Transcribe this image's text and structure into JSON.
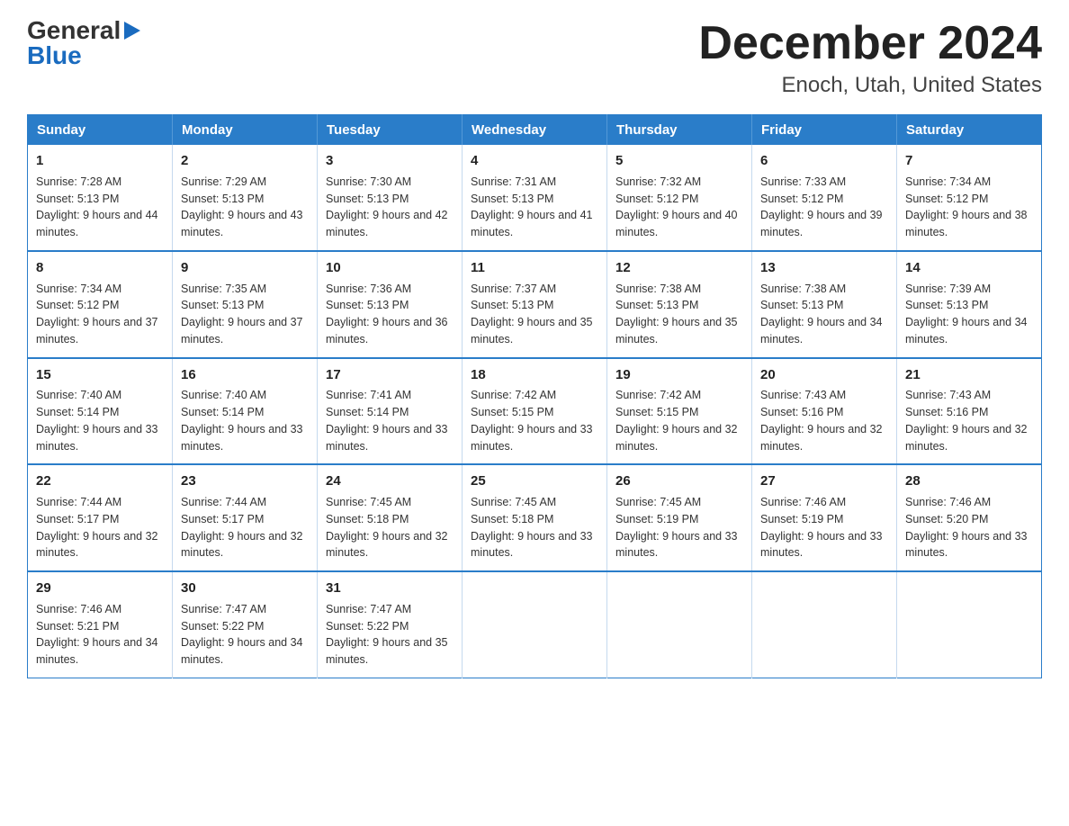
{
  "logo": {
    "general": "General",
    "blue": "Blue",
    "arrow": "▶"
  },
  "title": "December 2024",
  "subtitle": "Enoch, Utah, United States",
  "days_of_week": [
    "Sunday",
    "Monday",
    "Tuesday",
    "Wednesday",
    "Thursday",
    "Friday",
    "Saturday"
  ],
  "weeks": [
    [
      {
        "day": "1",
        "sunrise": "Sunrise: 7:28 AM",
        "sunset": "Sunset: 5:13 PM",
        "daylight": "Daylight: 9 hours and 44 minutes."
      },
      {
        "day": "2",
        "sunrise": "Sunrise: 7:29 AM",
        "sunset": "Sunset: 5:13 PM",
        "daylight": "Daylight: 9 hours and 43 minutes."
      },
      {
        "day": "3",
        "sunrise": "Sunrise: 7:30 AM",
        "sunset": "Sunset: 5:13 PM",
        "daylight": "Daylight: 9 hours and 42 minutes."
      },
      {
        "day": "4",
        "sunrise": "Sunrise: 7:31 AM",
        "sunset": "Sunset: 5:13 PM",
        "daylight": "Daylight: 9 hours and 41 minutes."
      },
      {
        "day": "5",
        "sunrise": "Sunrise: 7:32 AM",
        "sunset": "Sunset: 5:12 PM",
        "daylight": "Daylight: 9 hours and 40 minutes."
      },
      {
        "day": "6",
        "sunrise": "Sunrise: 7:33 AM",
        "sunset": "Sunset: 5:12 PM",
        "daylight": "Daylight: 9 hours and 39 minutes."
      },
      {
        "day": "7",
        "sunrise": "Sunrise: 7:34 AM",
        "sunset": "Sunset: 5:12 PM",
        "daylight": "Daylight: 9 hours and 38 minutes."
      }
    ],
    [
      {
        "day": "8",
        "sunrise": "Sunrise: 7:34 AM",
        "sunset": "Sunset: 5:12 PM",
        "daylight": "Daylight: 9 hours and 37 minutes."
      },
      {
        "day": "9",
        "sunrise": "Sunrise: 7:35 AM",
        "sunset": "Sunset: 5:13 PM",
        "daylight": "Daylight: 9 hours and 37 minutes."
      },
      {
        "day": "10",
        "sunrise": "Sunrise: 7:36 AM",
        "sunset": "Sunset: 5:13 PM",
        "daylight": "Daylight: 9 hours and 36 minutes."
      },
      {
        "day": "11",
        "sunrise": "Sunrise: 7:37 AM",
        "sunset": "Sunset: 5:13 PM",
        "daylight": "Daylight: 9 hours and 35 minutes."
      },
      {
        "day": "12",
        "sunrise": "Sunrise: 7:38 AM",
        "sunset": "Sunset: 5:13 PM",
        "daylight": "Daylight: 9 hours and 35 minutes."
      },
      {
        "day": "13",
        "sunrise": "Sunrise: 7:38 AM",
        "sunset": "Sunset: 5:13 PM",
        "daylight": "Daylight: 9 hours and 34 minutes."
      },
      {
        "day": "14",
        "sunrise": "Sunrise: 7:39 AM",
        "sunset": "Sunset: 5:13 PM",
        "daylight": "Daylight: 9 hours and 34 minutes."
      }
    ],
    [
      {
        "day": "15",
        "sunrise": "Sunrise: 7:40 AM",
        "sunset": "Sunset: 5:14 PM",
        "daylight": "Daylight: 9 hours and 33 minutes."
      },
      {
        "day": "16",
        "sunrise": "Sunrise: 7:40 AM",
        "sunset": "Sunset: 5:14 PM",
        "daylight": "Daylight: 9 hours and 33 minutes."
      },
      {
        "day": "17",
        "sunrise": "Sunrise: 7:41 AM",
        "sunset": "Sunset: 5:14 PM",
        "daylight": "Daylight: 9 hours and 33 minutes."
      },
      {
        "day": "18",
        "sunrise": "Sunrise: 7:42 AM",
        "sunset": "Sunset: 5:15 PM",
        "daylight": "Daylight: 9 hours and 33 minutes."
      },
      {
        "day": "19",
        "sunrise": "Sunrise: 7:42 AM",
        "sunset": "Sunset: 5:15 PM",
        "daylight": "Daylight: 9 hours and 32 minutes."
      },
      {
        "day": "20",
        "sunrise": "Sunrise: 7:43 AM",
        "sunset": "Sunset: 5:16 PM",
        "daylight": "Daylight: 9 hours and 32 minutes."
      },
      {
        "day": "21",
        "sunrise": "Sunrise: 7:43 AM",
        "sunset": "Sunset: 5:16 PM",
        "daylight": "Daylight: 9 hours and 32 minutes."
      }
    ],
    [
      {
        "day": "22",
        "sunrise": "Sunrise: 7:44 AM",
        "sunset": "Sunset: 5:17 PM",
        "daylight": "Daylight: 9 hours and 32 minutes."
      },
      {
        "day": "23",
        "sunrise": "Sunrise: 7:44 AM",
        "sunset": "Sunset: 5:17 PM",
        "daylight": "Daylight: 9 hours and 32 minutes."
      },
      {
        "day": "24",
        "sunrise": "Sunrise: 7:45 AM",
        "sunset": "Sunset: 5:18 PM",
        "daylight": "Daylight: 9 hours and 32 minutes."
      },
      {
        "day": "25",
        "sunrise": "Sunrise: 7:45 AM",
        "sunset": "Sunset: 5:18 PM",
        "daylight": "Daylight: 9 hours and 33 minutes."
      },
      {
        "day": "26",
        "sunrise": "Sunrise: 7:45 AM",
        "sunset": "Sunset: 5:19 PM",
        "daylight": "Daylight: 9 hours and 33 minutes."
      },
      {
        "day": "27",
        "sunrise": "Sunrise: 7:46 AM",
        "sunset": "Sunset: 5:19 PM",
        "daylight": "Daylight: 9 hours and 33 minutes."
      },
      {
        "day": "28",
        "sunrise": "Sunrise: 7:46 AM",
        "sunset": "Sunset: 5:20 PM",
        "daylight": "Daylight: 9 hours and 33 minutes."
      }
    ],
    [
      {
        "day": "29",
        "sunrise": "Sunrise: 7:46 AM",
        "sunset": "Sunset: 5:21 PM",
        "daylight": "Daylight: 9 hours and 34 minutes."
      },
      {
        "day": "30",
        "sunrise": "Sunrise: 7:47 AM",
        "sunset": "Sunset: 5:22 PM",
        "daylight": "Daylight: 9 hours and 34 minutes."
      },
      {
        "day": "31",
        "sunrise": "Sunrise: 7:47 AM",
        "sunset": "Sunset: 5:22 PM",
        "daylight": "Daylight: 9 hours and 35 minutes."
      },
      null,
      null,
      null,
      null
    ]
  ]
}
